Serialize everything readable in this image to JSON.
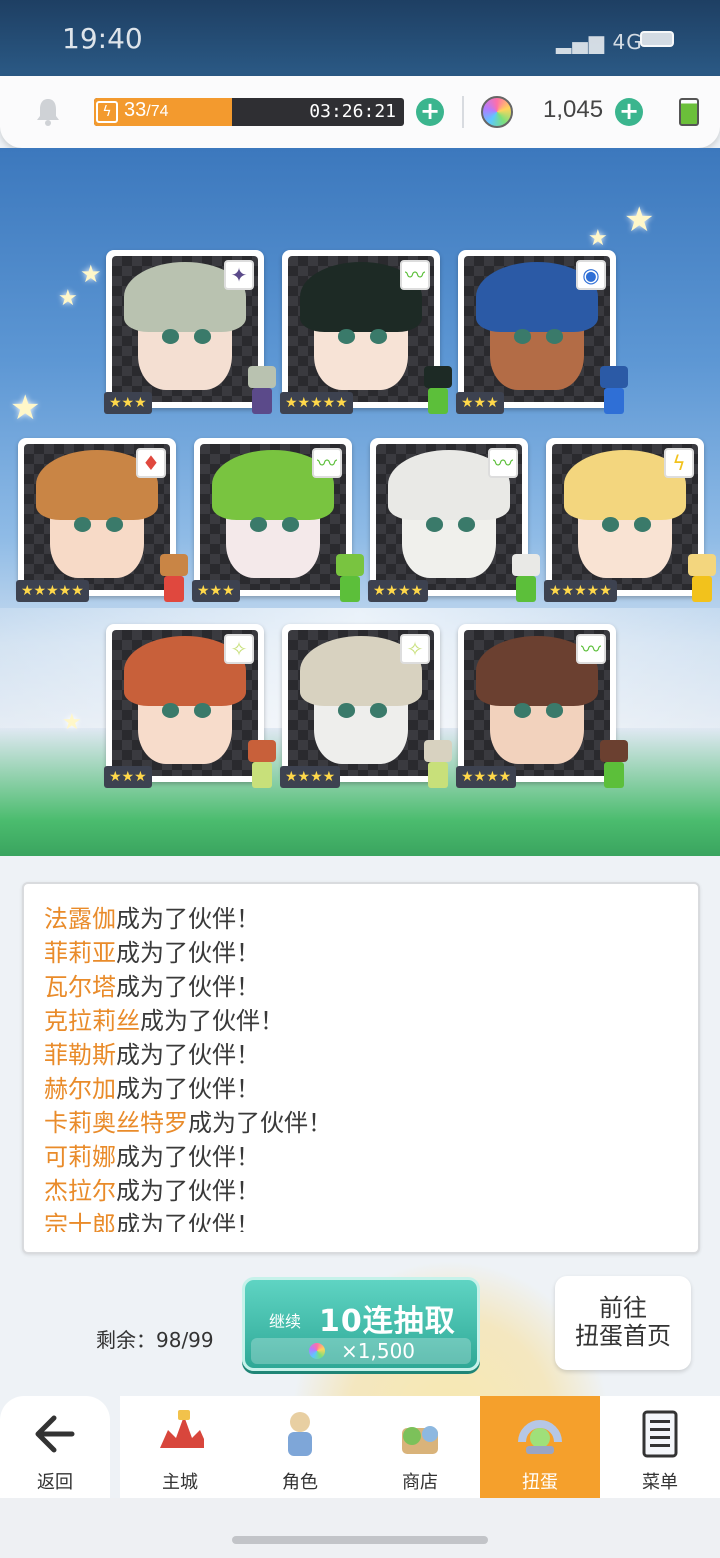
{
  "status_bar": {
    "time": "19:40",
    "network": "4G"
  },
  "resources": {
    "stamina_current": "33",
    "stamina_max": "/74",
    "stamina_fill_fraction": 0.446,
    "stamina_timer": "03:26:21",
    "gems": "1,045"
  },
  "cards": [
    {
      "element": "dark",
      "stars": 3,
      "hair": "#b9c2b0",
      "skin": "#f4dfd2"
    },
    {
      "element": "wind",
      "stars": 5,
      "hair": "#1d2a25",
      "skin": "#f7e3d6"
    },
    {
      "element": "water",
      "stars": 3,
      "hair": "#2b5aa6",
      "skin": "#b36c46"
    },
    {
      "element": "fire",
      "stars": 5,
      "hair": "#c98545",
      "skin": "#f7dac7"
    },
    {
      "element": "wind",
      "stars": 3,
      "hair": "#79c440",
      "skin": "#f4e9ea"
    },
    {
      "element": "wind",
      "stars": 4,
      "hair": "#e9e9e6",
      "skin": "#f0f0ec"
    },
    {
      "element": "thunder",
      "stars": 5,
      "hair": "#f3d67e",
      "skin": "#f9e3d3"
    },
    {
      "element": "light",
      "stars": 3,
      "hair": "#c8603a",
      "skin": "#f7dccb"
    },
    {
      "element": "light",
      "stars": 4,
      "hair": "#d8d2c0",
      "skin": "#eeeeec"
    },
    {
      "element": "wind",
      "stars": 4,
      "hair": "#6b4030",
      "skin": "#f2d2bd"
    }
  ],
  "element_icons": {
    "dark": "✦",
    "wind": "〰",
    "water": "◉",
    "fire": "♦",
    "thunder": "ϟ",
    "light": "✧"
  },
  "element_colors": {
    "dark": "#5b4a8a",
    "wind": "#5cbf3a",
    "water": "#2f6fd6",
    "fire": "#e0483e",
    "thunder": "#f2c21c",
    "light": "#c8e07a"
  },
  "log": {
    "suffix": "成为了伙伴！",
    "names": [
      "法露伽",
      "菲莉亚",
      "瓦尔塔",
      "克拉莉丝",
      "菲勒斯",
      "赫尔加",
      "卡莉奥丝特罗",
      "可莉娜",
      "杰拉尔",
      "宗十郎"
    ]
  },
  "remaining": "剩余：98/99",
  "pull_button": {
    "continue": "继续",
    "label": "10连抽取",
    "cost": "×1,500"
  },
  "home_button": {
    "line1": "前往",
    "line2": "扭蛋首页"
  },
  "nav": {
    "back": "返回",
    "items": [
      "主城",
      "角色",
      "商店",
      "扭蛋",
      "菜单"
    ],
    "active_index": 3
  }
}
